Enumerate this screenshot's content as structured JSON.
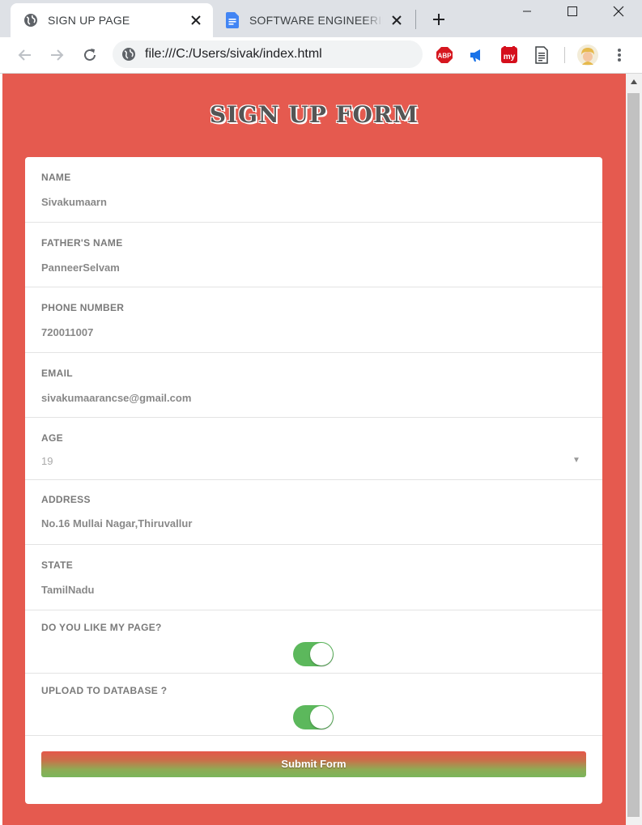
{
  "browser": {
    "tabs": [
      {
        "title": "SIGN UP PAGE",
        "favicon": "globe-icon",
        "active": true
      },
      {
        "title": "SOFTWARE ENGINEERING",
        "favicon": "google-docs-icon",
        "active": false
      }
    ],
    "address_bar": {
      "url": "file:///C:/Users/sivak/index.html"
    },
    "extensions": [
      "adblock-plus-icon",
      "megaphone-icon",
      "my-extension-icon",
      "document-icon"
    ],
    "extension_labels": {
      "abp": "ABP",
      "my": "my"
    }
  },
  "page": {
    "title": "SIGN UP FORM",
    "background_color": "#e55a4f",
    "form": {
      "fields": [
        {
          "label": "NAME",
          "value": "Sivakumaarn"
        },
        {
          "label": "FATHER'S NAME",
          "value": "PanneerSelvam"
        },
        {
          "label": "PHONE NUMBER",
          "value": "720011007"
        },
        {
          "label": "EMAIL",
          "value": "sivakumaarancse@gmail.com"
        },
        {
          "label": "AGE",
          "value": "19"
        },
        {
          "label": "ADDRESS",
          "value": "No.16 Mullai Nagar,Thiruvallur"
        },
        {
          "label": "STATE",
          "value": "TamilNadu"
        }
      ],
      "toggles": [
        {
          "label": "DO YOU LIKE MY PAGE?",
          "on": true
        },
        {
          "label": "UPLOAD TO DATABASE ?",
          "on": true
        }
      ],
      "toggle_color": "#5cb85c",
      "submit_label": "Submit Form"
    }
  }
}
